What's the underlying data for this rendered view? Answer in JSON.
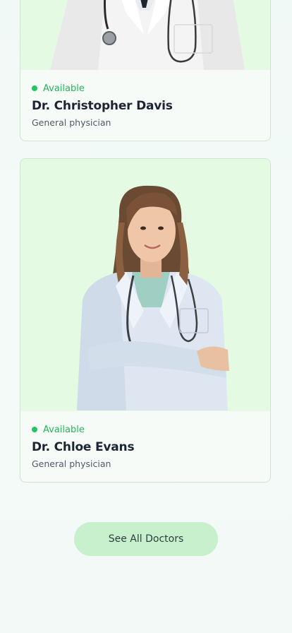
{
  "doctors": [
    {
      "status": "Available",
      "name": "Dr. Christopher Davis",
      "specialty": "General physician"
    },
    {
      "status": "Available",
      "name": "Dr. Chloe Evans",
      "specialty": "General physician"
    }
  ],
  "actions": {
    "see_all_label": "See All Doctors"
  },
  "colors": {
    "available_green": "#22c55e",
    "photo_background": "#e4fae2",
    "button_background": "#c8f0cc"
  }
}
